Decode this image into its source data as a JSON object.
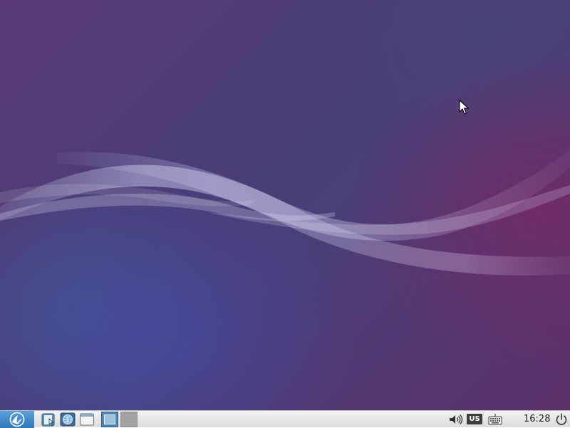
{
  "desktop": {
    "wallpaper": "lubuntu-default-waves",
    "accent_colors": [
      "#5a3a78",
      "#4a3f78",
      "#5b2f6a",
      "#46489f"
    ]
  },
  "taskbar": {
    "menu_icon": "lubuntu-menu-icon",
    "launchers": [
      {
        "icon": "file-manager-icon"
      },
      {
        "icon": "network-icon"
      },
      {
        "icon": "window-icon"
      }
    ],
    "workspaces": [
      {
        "active": true
      },
      {
        "active": false
      }
    ],
    "tray": {
      "volume_icon": "volume-icon",
      "keyboard_layout": "US",
      "keyboard_icon": "keyboard-icon",
      "clock": "16:28",
      "power_icon": "power-icon"
    }
  }
}
